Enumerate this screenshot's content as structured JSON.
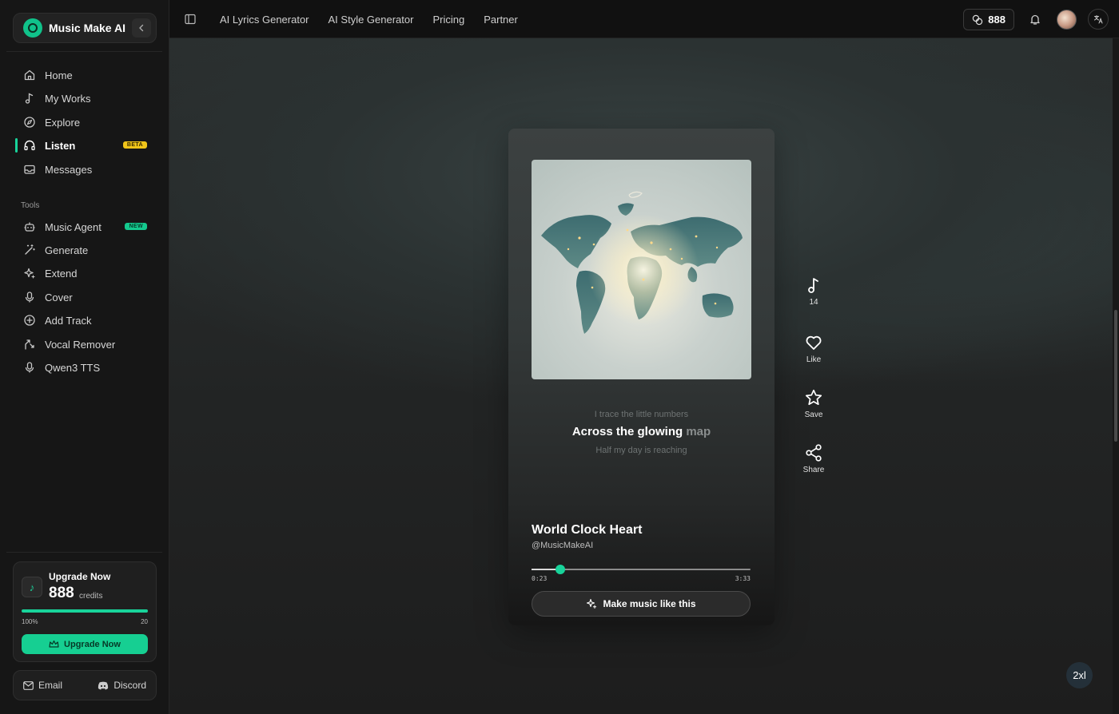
{
  "brand": {
    "name": "Music Make AI",
    "collapse_icon": "chevron-left-icon"
  },
  "sidebar": {
    "nav": [
      {
        "label": "Home",
        "icon": "home-icon"
      },
      {
        "label": "My Works",
        "icon": "music-note-icon"
      },
      {
        "label": "Explore",
        "icon": "compass-icon"
      },
      {
        "label": "Listen",
        "icon": "headphones-icon",
        "badge": "BETA",
        "active": true
      },
      {
        "label": "Messages",
        "icon": "inbox-icon"
      }
    ],
    "tools_label": "Tools",
    "tools": [
      {
        "label": "Music Agent",
        "icon": "bot-icon",
        "badge": "NEW"
      },
      {
        "label": "Generate",
        "icon": "magic-wand-icon"
      },
      {
        "label": "Extend",
        "icon": "sparkles-icon"
      },
      {
        "label": "Cover",
        "icon": "microphone-icon"
      },
      {
        "label": "Add Track",
        "icon": "plus-circle-icon"
      },
      {
        "label": "Vocal Remover",
        "icon": "split-icon"
      },
      {
        "label": "Qwen3 TTS",
        "icon": "microphone-icon"
      }
    ],
    "upgrade": {
      "title": "Upgrade Now",
      "credits": "888",
      "credits_label": "credits",
      "progress_fraction": 1.0,
      "progress_left": "100%",
      "progress_right": "20",
      "button": "Upgrade Now"
    },
    "footer": {
      "email": "Email",
      "discord": "Discord"
    }
  },
  "topbar": {
    "links": [
      "AI Lyrics Generator",
      "AI Style Generator",
      "Pricing",
      "Partner"
    ],
    "credits": "888"
  },
  "player": {
    "lyric_prev": "I trace the little numbers",
    "lyric_current_lit": "Across the glowing",
    "lyric_current_dim": "map",
    "lyric_next": "Half my day is reaching",
    "title": "World Clock Heart",
    "artist": "@MusicMakeAI",
    "time_current": "0:23",
    "time_total": "3:33",
    "progress_fraction": 0.13,
    "make_button": "Make music like this"
  },
  "actions": [
    {
      "label": "14",
      "icon": "music-note-icon"
    },
    {
      "label": "Like",
      "icon": "heart-icon"
    },
    {
      "label": "Save",
      "icon": "star-icon"
    },
    {
      "label": "Share",
      "icon": "share-icon"
    }
  ],
  "size_badge": "2xl",
  "colors": {
    "accent": "#18d39a",
    "beta": "#f0c419",
    "new": "#14c98e"
  }
}
